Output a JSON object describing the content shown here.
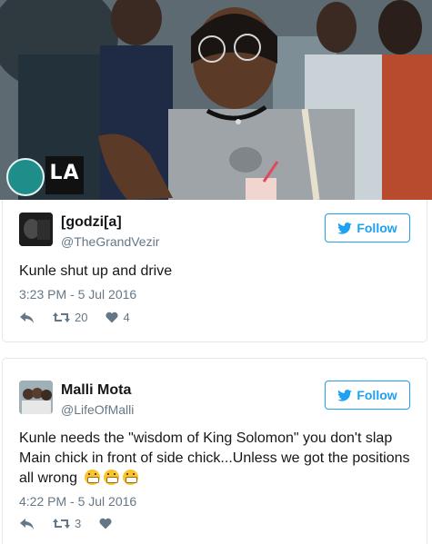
{
  "tweets": [
    {
      "display_name": "[godzi[a]",
      "handle": "@TheGrandVezir",
      "follow_label": "Follow",
      "text": "Kunle shut up and drive",
      "time": "3:23 PM - 5 Jul 2016",
      "retweets": "20",
      "likes": "4"
    },
    {
      "display_name": "Malli Mota",
      "handle": "@LifeOfMalli",
      "follow_label": "Follow",
      "text": "Kunle needs the \"wisdom of King Solomon\" you don't slap Main chick in front of side chick...Unless we got the positions all wrong",
      "time": "4:22 PM - 5 Jul 2016",
      "retweets": "3",
      "likes": ""
    }
  ],
  "photo": {
    "logo_text": "LA"
  },
  "colors": {
    "accent": "#1da1f2",
    "muted": "#657786",
    "border": "#e1e8ed"
  }
}
